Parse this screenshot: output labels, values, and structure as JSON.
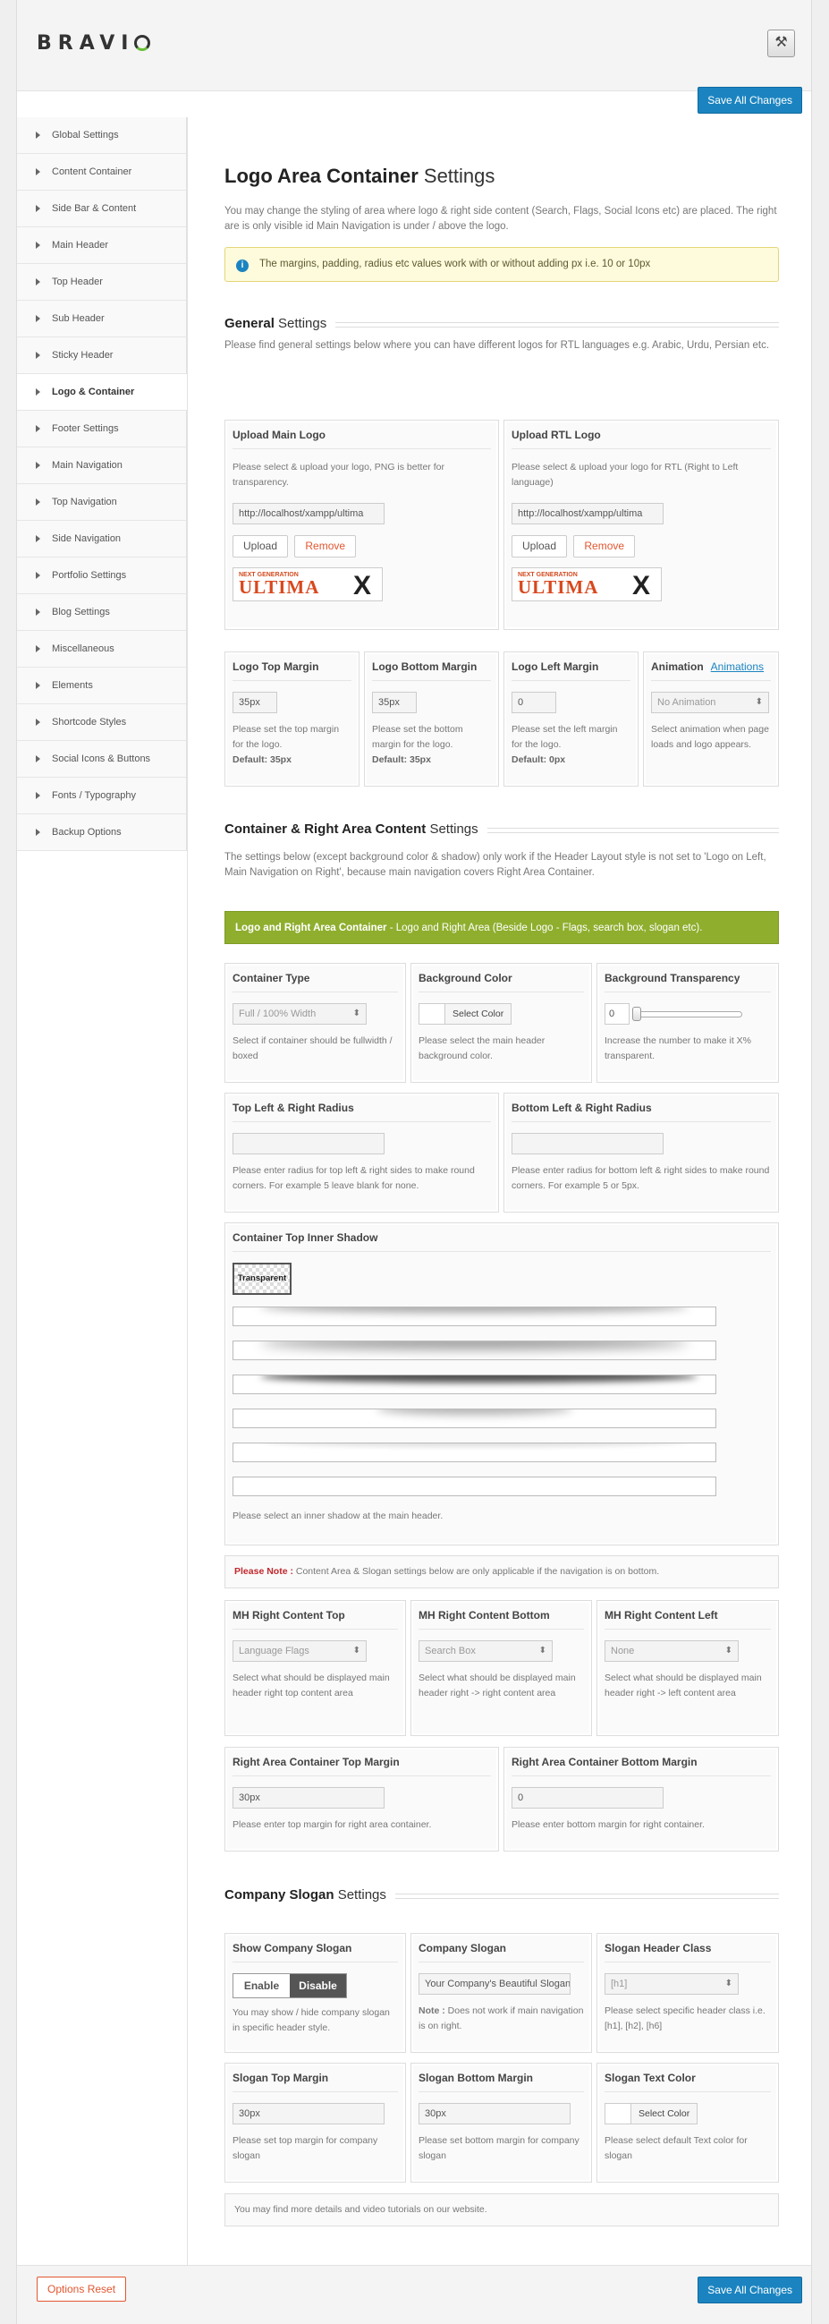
{
  "app": {
    "logo_text": "BRAVIO",
    "tools_icon": "tools-icon"
  },
  "buttons": {
    "save_top": "Save All Changes",
    "save_bottom": "Save All Changes",
    "reset": "Options Reset"
  },
  "sidebar": {
    "items": [
      "Global Settings",
      "Content Container",
      "Side Bar & Content",
      "Main Header",
      "Top Header",
      "Sub Header",
      "Sticky Header",
      "Logo & Container",
      "Footer Settings",
      "Main Navigation",
      "Top Navigation",
      "Side Navigation",
      "Portfolio Settings",
      "Blog Settings",
      "Miscellaneous",
      "Elements",
      "Shortcode Styles",
      "Social Icons & Buttons",
      "Fonts / Typography",
      "Backup Options"
    ],
    "active": "Logo & Container"
  },
  "page": {
    "title_bold": "Logo Area Container",
    "title_rest": "Settings",
    "intro": "You may change the styling of area where logo & right side content (Search, Flags, Social Icons etc) are placed. The right are is only visible id Main Navigation is under / above the logo.",
    "notice": "The margins, padding, radius etc values work with or without adding px i.e. 10 or 10px"
  },
  "general": {
    "title_bold": "General",
    "title_rest": "Settings",
    "desc": "Please find general settings below where you can have different logos for RTL languages e.g. Arabic, Urdu, Persian etc.",
    "main_logo": {
      "label": "Upload Main Logo",
      "desc": "Please select & upload your logo, PNG is better for transparency.",
      "url": "http://localhost/xampp/ultima",
      "upload": "Upload",
      "remove": "Remove"
    },
    "rtl_logo": {
      "label": "Upload RTL Logo",
      "desc": "Please select & upload your logo for RTL (Right to Left language)",
      "url": "http://localhost/xampp/ultima",
      "upload": "Upload",
      "remove": "Remove"
    },
    "preview": {
      "next": "NEXT",
      "generation": "GENERATION",
      "ultima": "ULTIMA",
      "x": "X"
    },
    "top_margin": {
      "label": "Logo Top Margin",
      "value": "35px",
      "desc": "Please set the top margin for the logo.",
      "default": "Default: 35px"
    },
    "bottom_margin": {
      "label": "Logo Bottom Margin",
      "value": "35px",
      "desc": "Please set the bottom margin for the logo.",
      "default": "Default: 35px"
    },
    "left_margin": {
      "label": "Logo Left Margin",
      "value": "0",
      "desc": "Please set the left margin for the logo.",
      "default": "Default: 0px"
    },
    "animation": {
      "label": "Animation",
      "link": "Animations",
      "value": "No Animation",
      "desc": "Select animation when page loads and logo appears."
    }
  },
  "container": {
    "title_bold": "Container & Right Area Content",
    "title_rest": "Settings",
    "desc": "The settings below (except background color & shadow) only work if the Header Layout style is not set to 'Logo on Left, Main Navigation on Right', because main navigation covers Right Area Container.",
    "banner_bold": "Logo and Right Area Container",
    "banner_rest": " - Logo and Right Area (Beside Logo - Flags, search box, slogan etc).",
    "type": {
      "label": "Container Type",
      "value": "Full / 100% Width",
      "desc": "Select if container should be fullwidth / boxed"
    },
    "bg_color": {
      "label": "Background Color",
      "button": "Select Color",
      "desc": "Please select the main header background color."
    },
    "bg_transp": {
      "label": "Background Transparency",
      "value": "0",
      "desc": "Increase the number to make it X% transparent."
    },
    "top_radius": {
      "label": "Top Left & Right Radius",
      "desc": "Please enter radius for top left & right sides to make round corners. For example 5 leave blank for none."
    },
    "bottom_radius": {
      "label": "Bottom Left & Right Radius",
      "desc": "Please enter radius for bottom left & right sides to make round corners. For example 5 or 5px."
    },
    "shadow": {
      "label": "Container Top Inner Shadow",
      "transparent": "Transparent",
      "desc": "Please select an inner shadow at the main header."
    },
    "note_bold": "Please Note :",
    "note_rest": " Content Area & Slogan settings below are only applicable if the navigation is on bottom.",
    "mh_top": {
      "label": "MH Right Content Top",
      "value": "Language Flags",
      "desc": "Select what should be displayed main header right top content area"
    },
    "mh_bottom": {
      "label": "MH Right Content Bottom",
      "value": "Search Box",
      "desc": "Select what should be displayed main header right -> right content area"
    },
    "mh_left": {
      "label": "MH Right Content Left",
      "value": "None",
      "desc": "Select what should be displayed main header right -> left content area"
    },
    "ra_top": {
      "label": "Right Area Container Top Margin",
      "value": "30px",
      "desc": "Please enter top margin for right area container."
    },
    "ra_bottom": {
      "label": "Right Area Container Bottom Margin",
      "value": "0",
      "desc": "Please enter bottom margin for right container."
    }
  },
  "slogan": {
    "title_bold": "Company Slogan",
    "title_rest": "Settings",
    "show": {
      "label": "Show Company Slogan",
      "enable": "Enable",
      "disable": "Disable",
      "desc": "You may show / hide company slogan in specific header style."
    },
    "text": {
      "label": "Company Slogan",
      "value": "Your Company's Beautiful Slogan",
      "note_bold": "Note :",
      "note_rest": " Does not work if main navigation is on right."
    },
    "header_class": {
      "label": "Slogan Header Class",
      "value": "[h1]",
      "desc": "Please select specific header class i.e. [h1], [h2], [h6]"
    },
    "top_margin": {
      "label": "Slogan Top Margin",
      "value": "30px",
      "desc": "Please set top margin for company slogan"
    },
    "bottom_margin": {
      "label": "Slogan Bottom Margin",
      "value": "30px",
      "desc": "Please set bottom margin for company slogan"
    },
    "text_color": {
      "label": "Slogan Text Color",
      "button": "Select Color",
      "desc": "Please select default Text color for slogan"
    },
    "footer_note": "You may find more details and video tutorials on our website."
  }
}
